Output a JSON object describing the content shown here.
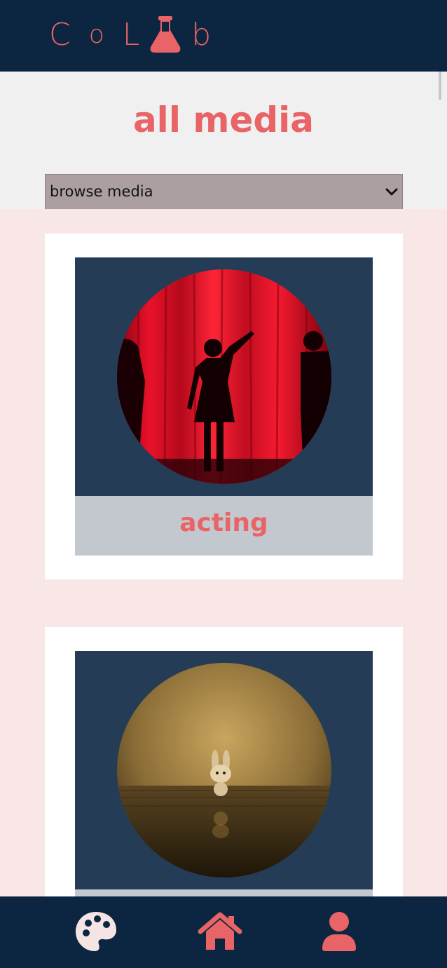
{
  "header": {
    "logo_letters": [
      "C",
      "o",
      "L",
      "b"
    ],
    "logo_icon": "flask-icon"
  },
  "page": {
    "title": "all media"
  },
  "browse_select": {
    "selected": "browse media"
  },
  "cards": [
    {
      "label": "acting",
      "image": "theatre-curtain-silhouettes-photo"
    },
    {
      "label": "",
      "image": "bunny-figurine-on-stage-photo"
    }
  ],
  "bottom_nav": {
    "items": [
      {
        "icon": "palette-icon"
      },
      {
        "icon": "home-icon"
      },
      {
        "icon": "user-icon"
      }
    ]
  },
  "colors": {
    "navy": "#0c2540",
    "accent": "#e86466",
    "card_image_bg": "#243c55",
    "label_bar": "#c3c8cf",
    "content_bg": "#f9e7e7",
    "select_bg": "#ab9fa2"
  }
}
